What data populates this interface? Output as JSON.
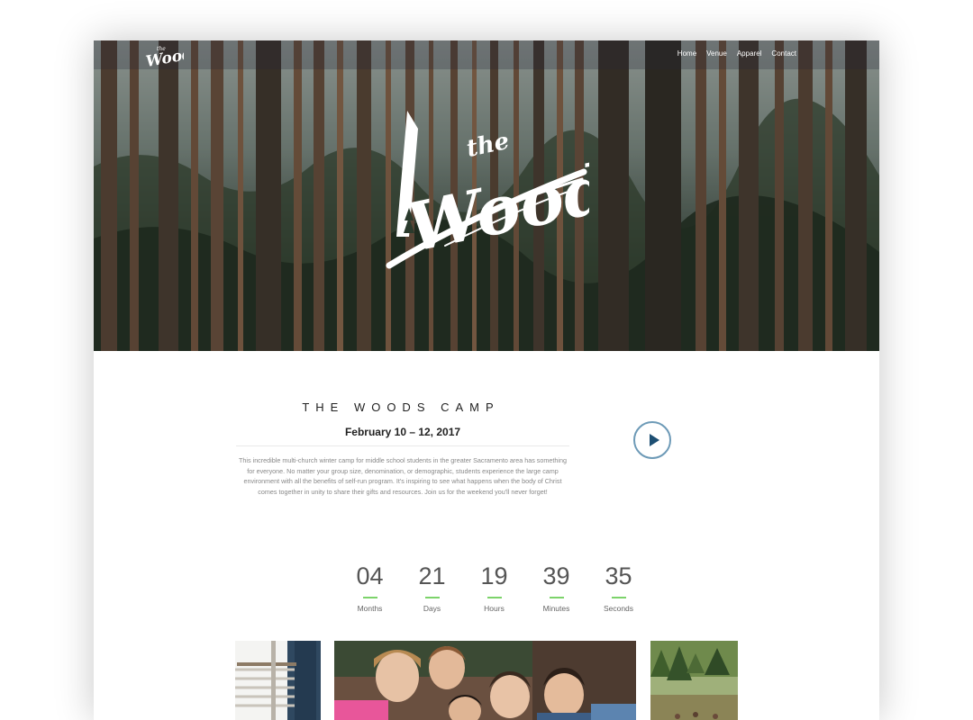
{
  "brand": {
    "logo_text": "Woods",
    "logo_small_word": "the",
    "hero_logo_word": "Woods",
    "hero_logo_small": "the"
  },
  "nav": {
    "items": [
      "Home",
      "Venue",
      "Apparel",
      "Contact"
    ]
  },
  "intro": {
    "title": "THE WOODS CAMP",
    "date": "February 10 – 12, 2017",
    "description": "This incredible multi-church winter camp for middle school students in the greater Sacramento area has something for everyone. No matter your group size, denomination, or demographic, students experience the large camp environment with all the benefits of self-run program. It's inspiring to see what happens when the body of Christ comes together in unity to share their gifts and resources. Join us for the weekend you'll never forget!",
    "play_icon": "play-icon"
  },
  "countdown": {
    "units": [
      {
        "value": "04",
        "label": "Months"
      },
      {
        "value": "21",
        "label": "Days"
      },
      {
        "value": "19",
        "label": "Hours"
      },
      {
        "value": "39",
        "label": "Minutes"
      },
      {
        "value": "35",
        "label": "Seconds"
      }
    ]
  },
  "colors": {
    "accent_green": "#7cd36a",
    "play_ring": "#6d9ab7",
    "play_icon": "#1d4f73"
  }
}
